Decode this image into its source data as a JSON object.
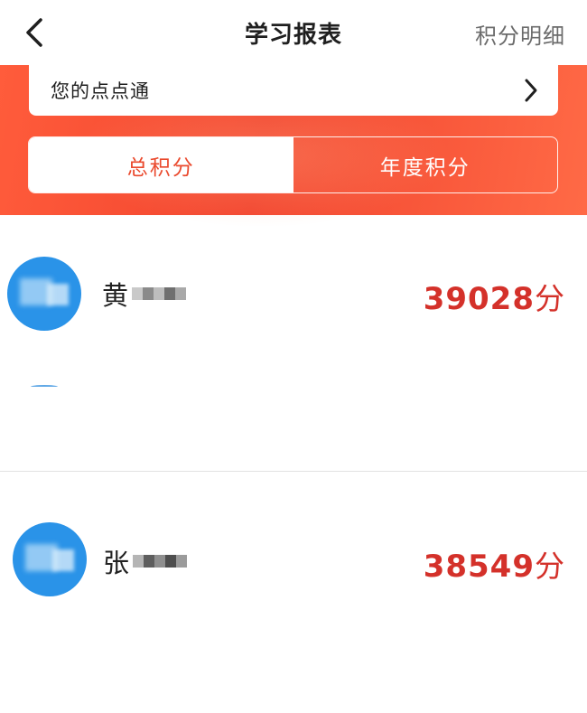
{
  "header": {
    "back_icon": "chevron-left-icon",
    "title": "学习报表",
    "points_detail_label": "积分明细"
  },
  "dian_dian_tong": {
    "label": "您的点点通",
    "icon": "chevron-right-icon"
  },
  "tabs": [
    {
      "label": "总积分",
      "active": true
    },
    {
      "label": "年度积分",
      "active": false
    }
  ],
  "colors": {
    "accent": "#ea4a2e",
    "score": "#d4312a",
    "avatar": "#2a93e8"
  },
  "rankings": [
    {
      "surname": "黄",
      "score": "39028",
      "unit": "分",
      "name_obscured": true
    },
    {
      "surname": "张",
      "score": "38549",
      "unit": "分",
      "name_obscured": true
    }
  ]
}
